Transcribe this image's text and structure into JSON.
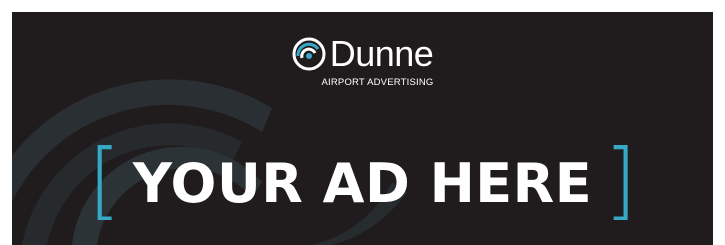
{
  "ad": {
    "brand_name": "Dunne",
    "brand_tagline": "AIRPORT ADVERTISING",
    "bracket_open": "[",
    "headline": "YOUR AD HERE",
    "bracket_close": "]",
    "logo_icon": "dunne-swirl-logo-icon",
    "colors": {
      "background": "#201c1d",
      "accent": "#35a9c6",
      "text": "#ffffff"
    }
  }
}
